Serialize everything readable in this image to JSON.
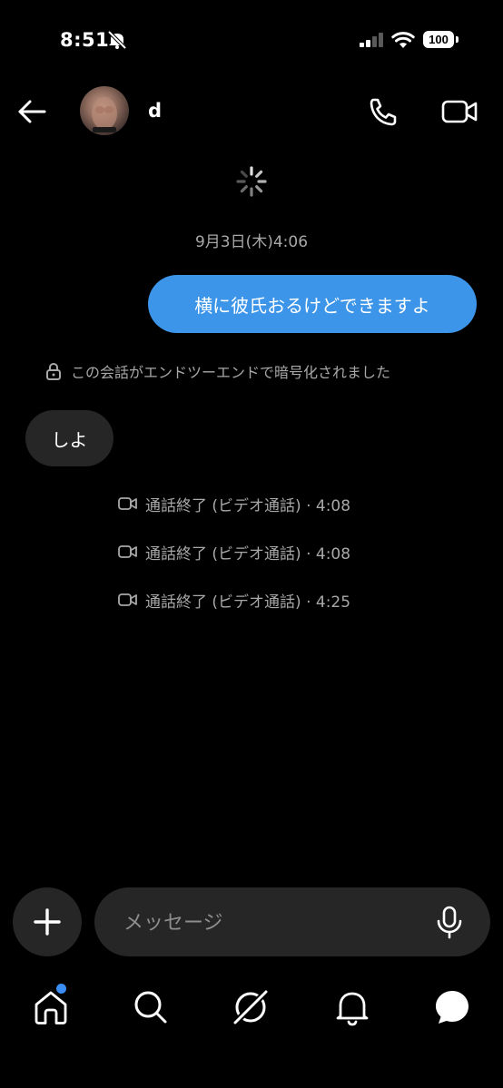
{
  "status_bar": {
    "time": "8:51",
    "battery": "100",
    "icons": [
      "mute-bell-icon",
      "signal-icon",
      "wifi-icon",
      "battery-icon"
    ]
  },
  "header": {
    "contact_name": "d",
    "icons": [
      "back-arrow-icon",
      "phone-icon",
      "video-camera-icon"
    ]
  },
  "chat": {
    "date_label": "9月3日(木)4:06",
    "outgoing_message": "横に彼氏おるけどできますよ",
    "e2e_notice": "この会話がエンドツーエンドで暗号化されました",
    "incoming_message": "しよ",
    "call_logs": [
      "通話終了 (ビデオ通話) · 4:08",
      "通話終了 (ビデオ通話) · 4:08",
      "通話終了 (ビデオ通話) · 4:25"
    ]
  },
  "composer": {
    "placeholder": "メッセージ",
    "value": ""
  },
  "bottom_nav": {
    "items": [
      "home-icon",
      "search-icon",
      "explore-icon",
      "notifications-icon",
      "messages-icon"
    ],
    "notification_dot_color": "#3a8ef6"
  },
  "colors": {
    "background": "#000000",
    "outgoing_bubble": "#3c95e8",
    "incoming_bubble": "#262626",
    "secondary_text": "#a8a8a8"
  }
}
